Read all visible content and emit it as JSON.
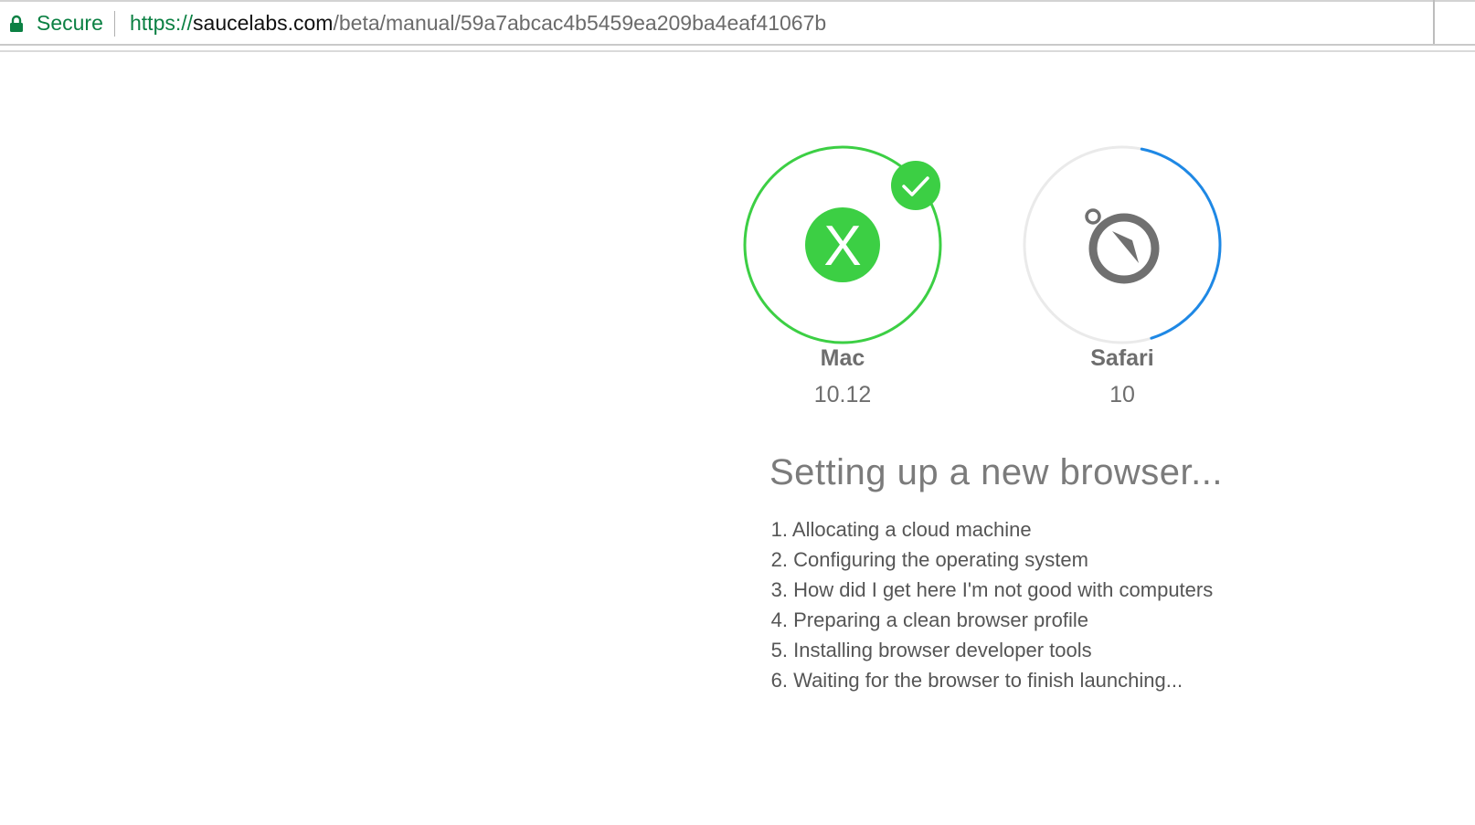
{
  "addressbar": {
    "secure_label": "Secure",
    "url_scheme": "https://",
    "url_host": "saucelabs.com",
    "url_path": "/beta/manual/59a7abcac4b5459ea209ba4eaf41067b"
  },
  "platform": {
    "name": "Mac",
    "version": "10.12",
    "status": "complete",
    "color": "#3ccf44"
  },
  "browser": {
    "name": "Safari",
    "version": "10",
    "status": "in-progress",
    "progress": 0.42,
    "color": "#1e88e5"
  },
  "setup": {
    "headline": "Setting up a new browser...",
    "steps": [
      {
        "num": "1.",
        "text": "Allocating a cloud machine"
      },
      {
        "num": "2.",
        "text": "Configuring the operating system"
      },
      {
        "num": "3.",
        "text": "How did I get here I'm not good with computers"
      },
      {
        "num": "4.",
        "text": "Preparing a clean browser profile"
      },
      {
        "num": "5.",
        "text": "Installing browser developer tools"
      },
      {
        "num": "6.",
        "text": "Waiting for the browser to finish launching..."
      }
    ]
  },
  "icons": {
    "lock": "lock-icon",
    "platform": "mac-os-x-icon",
    "check": "checkmark-icon",
    "browser": "safari-compass-icon"
  }
}
